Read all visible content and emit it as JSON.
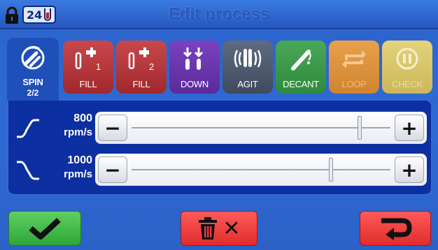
{
  "header": {
    "title": "Edit process",
    "tube_count": "24",
    "lock_icon": "lock-icon",
    "tube_icon": "test-tube-icon"
  },
  "tabs": [
    {
      "id": "spin",
      "label": "SPIN",
      "step": "2/2",
      "icon": "spin-icon",
      "active": true
    },
    {
      "id": "fill1",
      "label": "FILL",
      "badge": "1",
      "icon": "faucet-tube-icon",
      "color": "#b4363b"
    },
    {
      "id": "fill2",
      "label": "FILL",
      "badge": "2",
      "icon": "faucet-tube-icon",
      "color": "#b4363b"
    },
    {
      "id": "down",
      "label": "DOWN",
      "icon": "tubes-down-icon",
      "color": "#6a35ae"
    },
    {
      "id": "agit",
      "label": "AGIT",
      "icon": "agitate-icon",
      "color": "#4e596c"
    },
    {
      "id": "decant",
      "label": "DECANT",
      "icon": "decant-icon",
      "color": "#3c9a4a"
    },
    {
      "id": "loop",
      "label": "LOOP",
      "icon": "loop-icon",
      "color": "#dd923d",
      "disabled": true
    },
    {
      "id": "check",
      "label": "CHECK",
      "icon": "pause-icon",
      "color": "#d8c56a",
      "disabled": true
    }
  ],
  "settings": {
    "acceleration": {
      "value": "800",
      "unit": "rpm/s",
      "icon": "ramp-up-icon",
      "level": 0.88
    },
    "deceleration": {
      "value": "1000",
      "unit": "rpm/s",
      "icon": "ramp-down-icon",
      "level": 0.77
    }
  },
  "slider_buttons": {
    "minus": "−",
    "plus": "+"
  },
  "footer": {
    "confirm_icon": "checkmark-icon",
    "delete_icon": "trash-icon",
    "delete_x": "✕",
    "back_icon": "return-arrow-icon"
  },
  "colors": {
    "accent": "#2a63cc",
    "panel": "#0c2fa2",
    "ok": "#3bb547",
    "danger": "#e8383a"
  }
}
